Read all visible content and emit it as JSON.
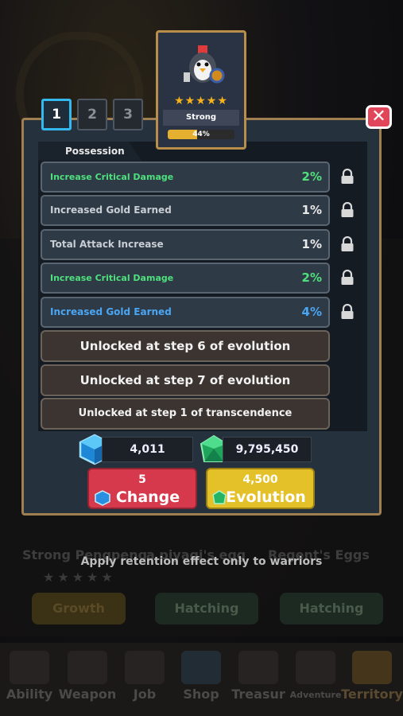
{
  "background": {
    "names": [
      "Strong Pengpeng",
      "a piyagi's egg",
      "Regent's Eggs"
    ],
    "buttons": [
      "Growth",
      "Hatching",
      "Hatching"
    ],
    "stars": "★★★★★",
    "note": "Apply retention effect only to warriors"
  },
  "nav": {
    "items": [
      {
        "label": "Ability",
        "icon": "ability-icon"
      },
      {
        "label": "Weapon",
        "icon": "weapon-icon"
      },
      {
        "label": "Job",
        "icon": "job-icon"
      },
      {
        "label": "Shop",
        "icon": "shop-icon"
      },
      {
        "label": "Treasur",
        "icon": "treasure-icon"
      },
      {
        "label": "Adventure",
        "icon": "adventure-icon"
      },
      {
        "label": "Territory",
        "icon": "territory-icon"
      }
    ],
    "active_index": 6
  },
  "card": {
    "name": "Strong Pengpeng",
    "stars": "★★★★★",
    "progress_text": "44%",
    "progress": 0.44
  },
  "tabs": [
    "1",
    "2",
    "3"
  ],
  "active_tab": 0,
  "possession_label": "Possession",
  "options": [
    {
      "label": "Increase Critical Damage",
      "value": "2%",
      "color": "#4ee07c",
      "locked": true
    },
    {
      "label": "Increased Gold Earned",
      "value": "1%",
      "color": "#c9ced4",
      "locked": true
    },
    {
      "label": "Total Attack Increase",
      "value": "1%",
      "color": "#c9ced4",
      "locked": true
    },
    {
      "label": "Increase Critical Damage",
      "value": "2%",
      "color": "#4ee07c",
      "locked": true
    },
    {
      "label": "Increased Gold Earned",
      "value": "4%",
      "color": "#4aa6f2",
      "locked": true
    }
  ],
  "unlocks": [
    "Unlocked at step 6 of evolution",
    "Unlocked at step 7 of evolution",
    "Unlocked at step 1 of transcendence"
  ],
  "resources": {
    "blue_cube": "4,011",
    "green_gem": "9,795,450"
  },
  "buttons": {
    "change": {
      "cost": "5",
      "label": "Change"
    },
    "evolution": {
      "cost": "4,500",
      "label": "Evolution"
    }
  },
  "colors": {
    "accent_blue": "#35b8ee",
    "green_text": "#4ee07c",
    "blue_text": "#4aa6f2",
    "change_red": "#d6394c",
    "evolution_yellow": "#e4c029",
    "close_red": "#e1455a",
    "frame_gold": "#a07f51"
  }
}
